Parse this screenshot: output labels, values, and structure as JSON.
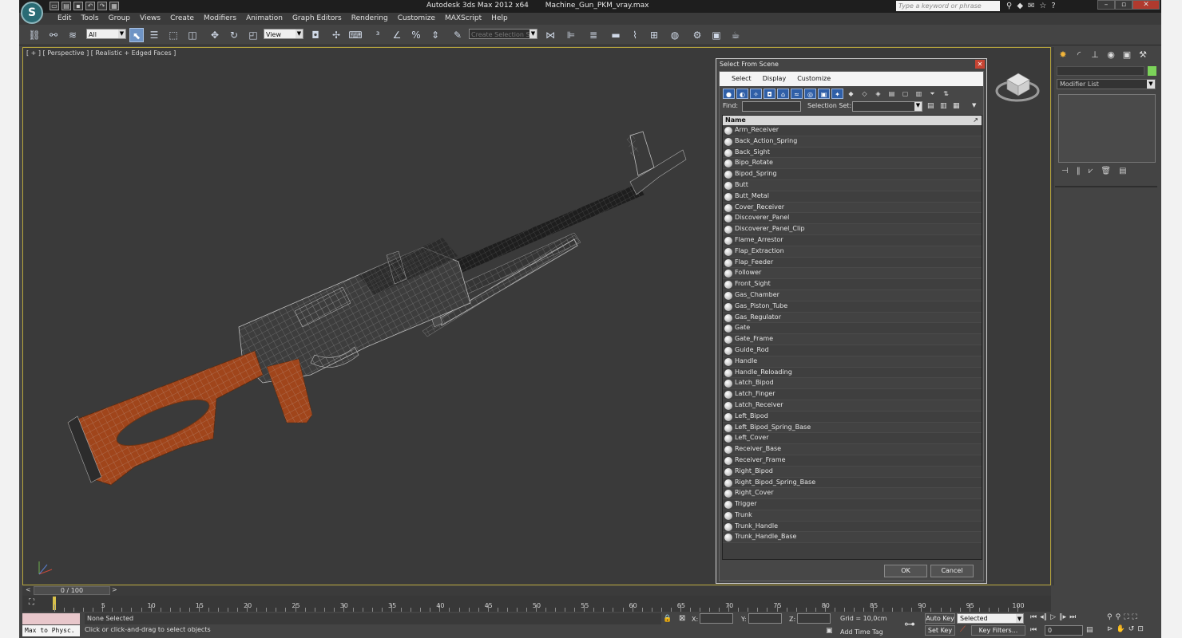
{
  "titlebar": {
    "app_name": "Autodesk 3ds Max  2012 x64",
    "file_name": "Machine_Gun_PKM_vray.max",
    "search_placeholder": "Type a keyword or phrase"
  },
  "menu": [
    "Edit",
    "Tools",
    "Group",
    "Views",
    "Create",
    "Modifiers",
    "Animation",
    "Graph Editors",
    "Rendering",
    "Customize",
    "MAXScript",
    "Help"
  ],
  "toolbar": {
    "selection_filter": "All",
    "ref_coord": "View",
    "named_selection_placeholder": "Create Selection Se"
  },
  "viewport": {
    "label": "[ + ] [ Perspective ] [ Realistic + Edged Faces ]"
  },
  "dialog": {
    "title": "Select From Scene",
    "menu": [
      "Select",
      "Display",
      "Customize"
    ],
    "find_label": "Find:",
    "selection_set_label": "Selection Set:",
    "column_header": "Name",
    "items": [
      "Arm_Receiver",
      "Back_Action_Spring",
      "Back_Sight",
      "Bipo_Rotate",
      "Bipod_Spring",
      "Butt",
      "Butt_Metal",
      "Cover_Receiver",
      "Discoverer_Panel",
      "Discoverer_Panel_Clip",
      "Flame_Arrestor",
      "Flap_Extraction",
      "Flap_Feeder",
      "Follower",
      "Front_Sight",
      "Gas_Chamber",
      "Gas_Piston_Tube",
      "Gas_Regulator",
      "Gate",
      "Gate_Frame",
      "Guide_Rod",
      "Handle",
      "Handle_Reloading",
      "Latch_Bipod",
      "Latch_Finger",
      "Latch_Receiver",
      "Left_Bipod",
      "Left_Bipod_Spring_Base",
      "Left_Cover",
      "Receiver_Base",
      "Receiver_Frame",
      "Right_Bipod",
      "Right_Bipod_Spring_Base",
      "Right_Cover",
      "Trigger",
      "Trunk",
      "Trunk_Handle",
      "Trunk_Handle_Base"
    ],
    "ok_label": "OK",
    "cancel_label": "Cancel"
  },
  "command_panel": {
    "modifier_list": "Modifier List",
    "object_color": "#7cd35a"
  },
  "timeline": {
    "frame_display": "0 / 100",
    "ticks": [
      "5",
      "10",
      "15",
      "20",
      "25",
      "30",
      "35",
      "40",
      "45",
      "50",
      "55",
      "60",
      "65",
      "70",
      "75",
      "80",
      "85",
      "90",
      "95",
      "100"
    ]
  },
  "status": {
    "maxscript": "Max to Physc.",
    "selection": "None Selected",
    "prompt": "Click or click-and-drag to select objects",
    "x_label": "X:",
    "y_label": "Y:",
    "z_label": "Z:",
    "grid": "Grid = 10,0cm",
    "add_time_tag": "Add Time Tag",
    "auto_key": "Auto Key",
    "set_key": "Set Key",
    "key_mode": "Selected",
    "key_filters": "Key Filters...",
    "current_frame": "0"
  },
  "colors": {
    "stock_wood": "#a0451b",
    "viewport_border": "#b8a63c",
    "accent_blue": "#2f5fa7"
  }
}
